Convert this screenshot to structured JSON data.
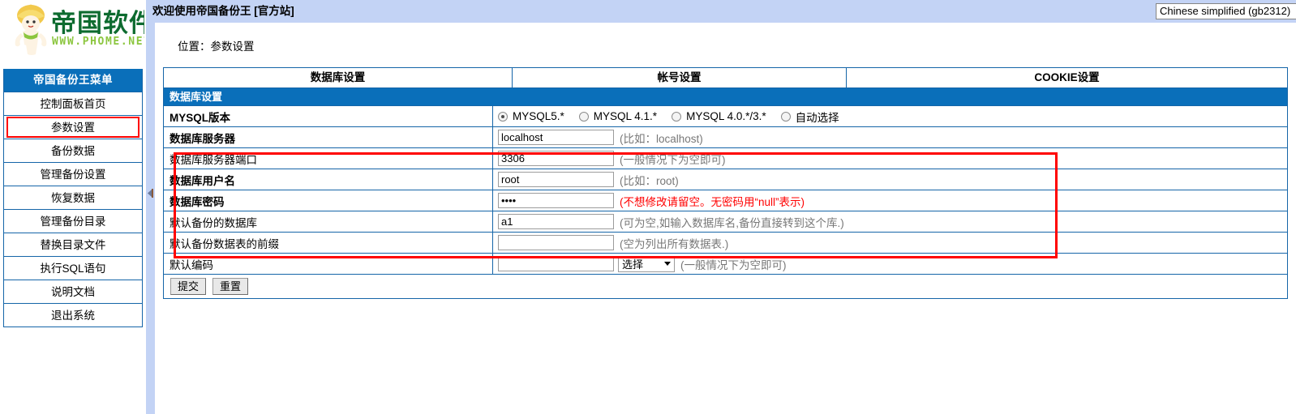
{
  "topbar": {
    "title": "欢迎使用帝国备份王 [官方站]",
    "language_selected": "Chinese simplified (gb2312)"
  },
  "sidebar": {
    "logo": {
      "brand": "帝国软件",
      "url": "WWW.PHOME.NET"
    },
    "menu_title": "帝国备份王菜单",
    "items": [
      {
        "label": "控制面板首页",
        "active": false
      },
      {
        "label": "参数设置",
        "active": true
      },
      {
        "label": "备份数据",
        "active": false
      },
      {
        "label": "管理备份设置",
        "active": false
      },
      {
        "label": "恢复数据",
        "active": false
      },
      {
        "label": "管理备份目录",
        "active": false
      },
      {
        "label": "替换目录文件",
        "active": false
      },
      {
        "label": "执行SQL语句",
        "active": false
      },
      {
        "label": "说明文档",
        "active": false
      },
      {
        "label": "退出系统",
        "active": false
      }
    ]
  },
  "content": {
    "breadcrumb": "位置：参数设置",
    "tabs": [
      {
        "label": "数据库设置"
      },
      {
        "label": "帐号设置"
      },
      {
        "label": "COOKIE设置"
      }
    ],
    "section_title": "数据库设置",
    "mysql_version": {
      "label": "MYSQL版本",
      "options": [
        {
          "label": "MYSQL5.*",
          "selected": true
        },
        {
          "label": "MYSQL 4.1.*",
          "selected": false
        },
        {
          "label": "MYSQL 4.0.*/3.*",
          "selected": false
        },
        {
          "label": "自动选择",
          "selected": false
        }
      ]
    },
    "fields": [
      {
        "label": "数据库服务器",
        "bold": true,
        "value": "localhost",
        "placeholder": "",
        "hint": "(比如：localhost)",
        "hint_red": false
      },
      {
        "label": "数据库服务器端口",
        "bold": false,
        "value": "3306",
        "placeholder": "",
        "hint": "(一般情况下为空即可)",
        "hint_red": false
      },
      {
        "label": "数据库用户名",
        "bold": true,
        "value": "root",
        "placeholder": "",
        "hint": "(比如：root)",
        "hint_red": false
      },
      {
        "label": "数据库密码",
        "bold": true,
        "value": "••••",
        "placeholder": "",
        "hint": "(不想修改请留空。无密码用“null”表示)",
        "hint_red": true
      },
      {
        "label": "默认备份的数据库",
        "bold": false,
        "value": "a1",
        "placeholder": "",
        "hint": "(可为空,如输入数据库名,备份直接转到这个库.)",
        "hint_red": false
      },
      {
        "label": "默认备份数据表的前缀",
        "bold": false,
        "value": "",
        "placeholder": "",
        "hint": "(空为列出所有数据表.)",
        "hint_red": false
      }
    ],
    "encoding_row": {
      "label": "默认编码",
      "value": "",
      "placeholder": "",
      "select_value": "选择",
      "hint": "(一般情况下为空即可)"
    },
    "buttons": [
      {
        "label": "提交"
      },
      {
        "label": "重置"
      }
    ]
  },
  "colors": {
    "brand_blue": "#0a6fba",
    "border_blue": "#1565a8",
    "topbar_blue": "#c3d3f5",
    "highlight_red": "#ff0000",
    "hint_gray": "#777777"
  }
}
